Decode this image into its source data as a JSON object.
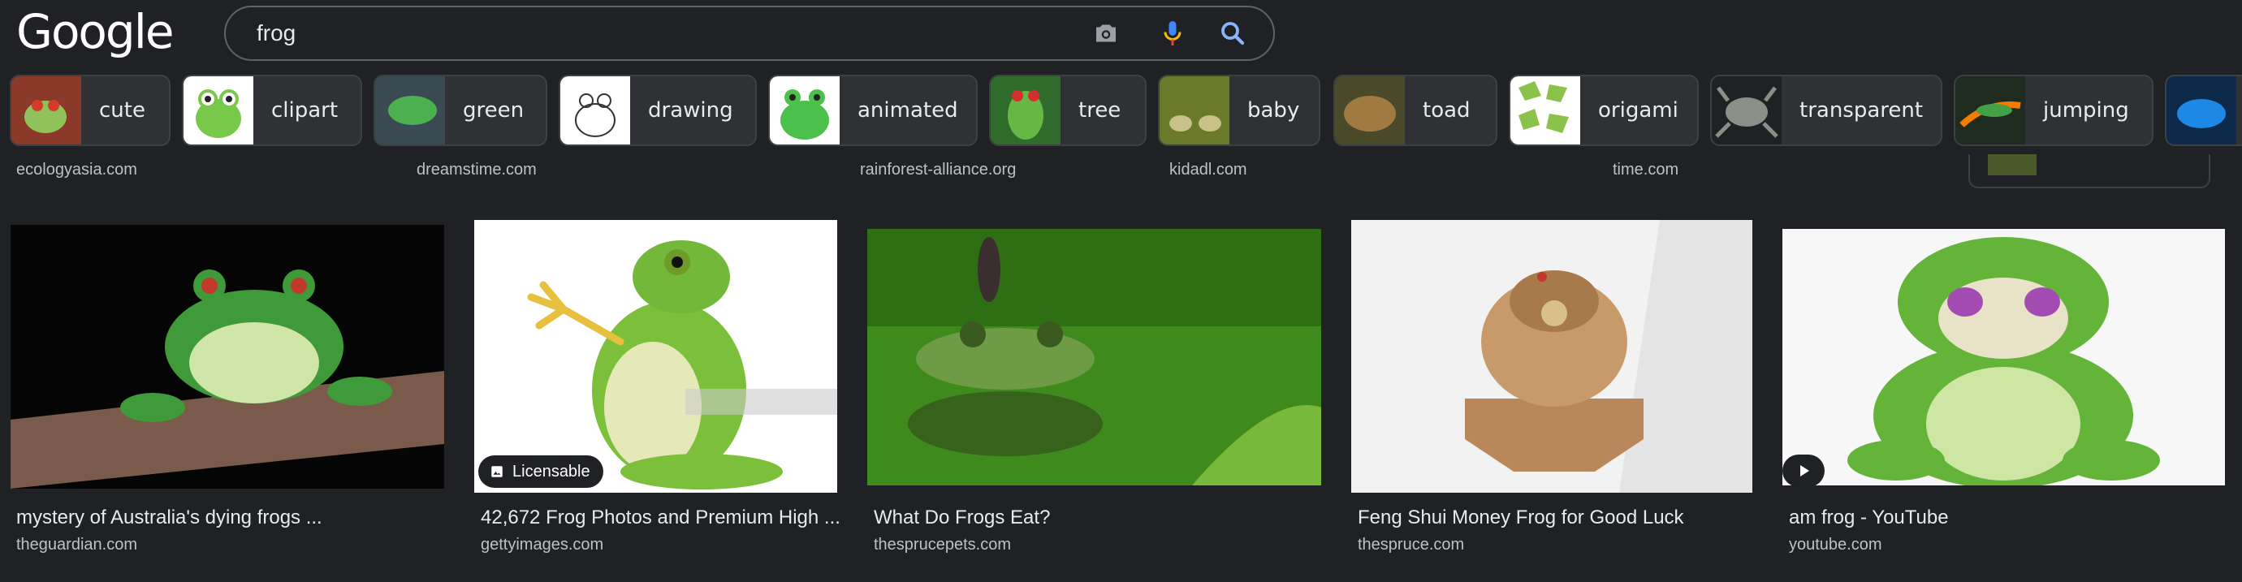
{
  "header": {
    "logo": "Google",
    "query": "frog"
  },
  "chips": [
    {
      "label": "cute",
      "thumb": "red-eyed-frog"
    },
    {
      "label": "clipart",
      "thumb": "cartoon-frog"
    },
    {
      "label": "green",
      "thumb": "green-frog"
    },
    {
      "label": "drawing",
      "thumb": "frog-drawing"
    },
    {
      "label": "animated",
      "thumb": "animated-frog"
    },
    {
      "label": "tree",
      "thumb": "tree-frog"
    },
    {
      "label": "baby",
      "thumb": "baby-frogs"
    },
    {
      "label": "toad",
      "thumb": "toad"
    },
    {
      "label": "origami",
      "thumb": "origami-frog"
    },
    {
      "label": "transparent",
      "thumb": "transparent-frog"
    },
    {
      "label": "jumping",
      "thumb": "jumping-frog"
    }
  ],
  "top_sources": [
    "ecologyasia.com",
    "dreamstime.com",
    "rainforest-alliance.org",
    "kidadl.com",
    "time.com"
  ],
  "results": [
    {
      "title": "mystery of Australia's dying frogs ...",
      "source": "theguardian.com"
    },
    {
      "title": "42,672 Frog Photos and Premium High ...",
      "source": "gettyimages.com",
      "badge": "Licensable"
    },
    {
      "title": "What Do Frogs Eat?",
      "source": "thesprucepets.com"
    },
    {
      "title": "Feng Shui Money Frog for Good Luck",
      "source": "thespruce.com"
    },
    {
      "title": "am frog - YouTube",
      "source": "youtube.com"
    }
  ],
  "colors": {
    "background": "#202124",
    "chip": "#303134",
    "chip_border": "#3c4043",
    "text": "#e8eaed",
    "secondary_text": "#bdc1c6",
    "mic_blue": "#4285f4",
    "mic_red": "#ea4335",
    "search_blue": "#8ab4f8"
  },
  "icons": [
    "camera-icon",
    "mic-icon",
    "search-icon",
    "image-icon",
    "play-icon"
  ]
}
